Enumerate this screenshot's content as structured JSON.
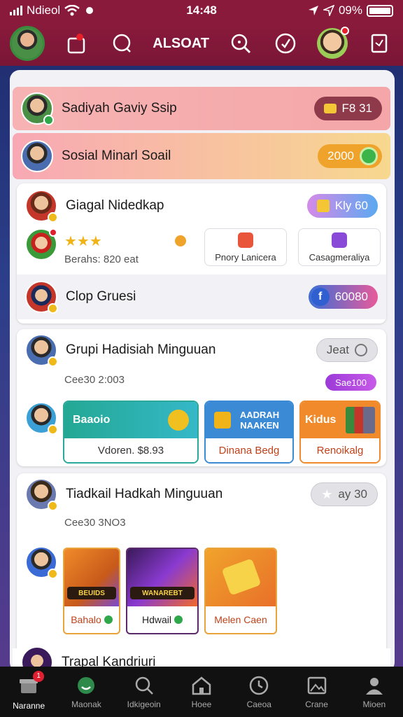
{
  "status_bar": {
    "carrier": "Ndieol",
    "time": "14:48",
    "battery": "09%"
  },
  "header": {
    "title": "ALSOAT"
  },
  "rows": [
    {
      "name": "Sadiyah Gaviy Ssip",
      "badge": "F8 31"
    },
    {
      "name": "Sosial Minarl Soail",
      "badge": "2000"
    },
    {
      "name": "Giagal Nidedkap",
      "badge": "Kly 60"
    },
    {
      "rating": "★★★",
      "subtitle": "Berahs: 820 eat",
      "btn1": "Pnory Lanicera",
      "btn2": "Casagmeraliya"
    },
    {
      "name": "Clop Gruesi",
      "badge": "60080"
    }
  ],
  "card1": {
    "title": "Grupi Hadisiah Minguuan",
    "badge": "Jeat",
    "meta": "Cee30 2:003",
    "pill": "Sae100",
    "promo1": {
      "top": "Baaoio",
      "bottom": "Vdoren. $8.93"
    },
    "promo2": {
      "top": "AADRAH NAAKEN",
      "bottom": "Dinana Bedg"
    },
    "promo3": {
      "top": "Kidus",
      "bottom": "Renoikalg"
    }
  },
  "card2": {
    "title": "Tiadkail Hadkah Minguuan",
    "badge": "ay 30",
    "meta": "Cee30 3NO3",
    "games": [
      {
        "tag": "BEUIDS",
        "label": "Bahalo"
      },
      {
        "tag": "WANAREBT",
        "label": "Hdwail"
      },
      {
        "tag": "",
        "label": "Melen Caen"
      }
    ]
  },
  "next_row": {
    "name": "Trapal Kandriuri"
  },
  "nav": [
    {
      "label": "Naranne",
      "icon": "gift-icon",
      "badge": "1"
    },
    {
      "label": "Maonak",
      "icon": "smile-icon"
    },
    {
      "label": "Idkigeoin",
      "icon": "search-icon"
    },
    {
      "label": "Hoee",
      "icon": "home-icon"
    },
    {
      "label": "Caeoa",
      "icon": "clock-icon"
    },
    {
      "label": "Crane",
      "icon": "image-icon"
    },
    {
      "label": "Mioen",
      "icon": "person-icon"
    }
  ],
  "colors": {
    "header": "#8a1a3c",
    "accent_orange": "#f0a32b",
    "accent_blue": "#3b8ad6"
  }
}
